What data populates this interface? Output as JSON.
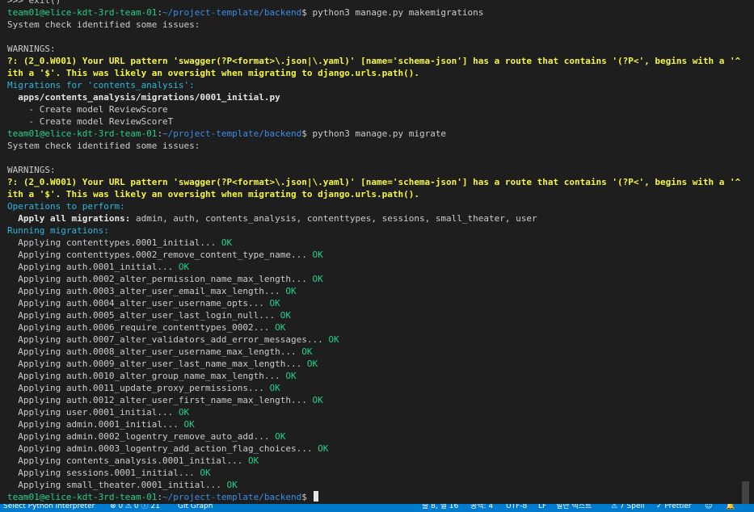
{
  "colors": {
    "background": "#1e1e1e",
    "prompt_user": "#23d18b",
    "prompt_path": "#3b8eea",
    "warning": "#f5f543",
    "section_header": "#29b8db",
    "ok": "#23d18b",
    "statusbar": "#007acc"
  },
  "terminal": {
    "lines": [
      {
        "segments": [
          {
            "text": ">>> exit()",
            "style": "white"
          }
        ]
      },
      {
        "segments": [
          {
            "text": "team01@elice-kdt-3rd-team-01",
            "style": "green"
          },
          {
            "text": ":",
            "style": "white"
          },
          {
            "text": "~/project-template/backend",
            "style": "blue"
          },
          {
            "text": "$ python3 manage.py makemigrations",
            "style": "white"
          }
        ]
      },
      {
        "segments": [
          {
            "text": "System check identified some issues:",
            "style": "white"
          }
        ]
      },
      {
        "segments": [
          {
            "text": "",
            "style": "white"
          }
        ]
      },
      {
        "segments": [
          {
            "text": "WARNINGS:",
            "style": "white"
          }
        ]
      },
      {
        "segments": [
          {
            "text": "?: (2_0.W001) Your URL pattern 'swagger(?P<format>\\.json|\\.yaml)' [name='schema-json'] has a route that contains '(?P<', begins with a '^', or ends w",
            "style": "yellow"
          }
        ]
      },
      {
        "segments": [
          {
            "text": "ith a '$'. This was likely an oversight when migrating to django.urls.path().",
            "style": "yellow"
          }
        ]
      },
      {
        "segments": [
          {
            "text": "Migrations for 'contents_analysis':",
            "style": "cyan"
          }
        ]
      },
      {
        "segments": [
          {
            "text": "  apps/contents_analysis/migrations/0001_initial.py",
            "style": "bold"
          }
        ]
      },
      {
        "segments": [
          {
            "text": "    - Create model ReviewScore",
            "style": "white"
          }
        ]
      },
      {
        "segments": [
          {
            "text": "    - Create model ReviewScoreT",
            "style": "white"
          }
        ]
      },
      {
        "segments": [
          {
            "text": "team01@elice-kdt-3rd-team-01",
            "style": "green"
          },
          {
            "text": ":",
            "style": "white"
          },
          {
            "text": "~/project-template/backend",
            "style": "blue"
          },
          {
            "text": "$ python3 manage.py migrate",
            "style": "white"
          }
        ]
      },
      {
        "segments": [
          {
            "text": "System check identified some issues:",
            "style": "white"
          }
        ]
      },
      {
        "segments": [
          {
            "text": "",
            "style": "white"
          }
        ]
      },
      {
        "segments": [
          {
            "text": "WARNINGS:",
            "style": "white"
          }
        ]
      },
      {
        "segments": [
          {
            "text": "?: (2_0.W001) Your URL pattern 'swagger(?P<format>\\.json|\\.yaml)' [name='schema-json'] has a route that contains '(?P<', begins with a '^', or ends w",
            "style": "yellow"
          }
        ]
      },
      {
        "segments": [
          {
            "text": "ith a '$'. This was likely an oversight when migrating to django.urls.path().",
            "style": "yellow"
          }
        ]
      },
      {
        "segments": [
          {
            "text": "Operations to perform:",
            "style": "cyan"
          }
        ]
      },
      {
        "segments": [
          {
            "text": "  Apply all migrations:",
            "style": "bold"
          },
          {
            "text": " admin, auth, contents_analysis, contenttypes, sessions, small_theater, user",
            "style": "white"
          }
        ]
      },
      {
        "segments": [
          {
            "text": "Running migrations:",
            "style": "cyan"
          }
        ]
      },
      {
        "segments": [
          {
            "text": "  Applying contenttypes.0001_initial...",
            "style": "white"
          },
          {
            "text": " OK",
            "style": "green"
          }
        ]
      },
      {
        "segments": [
          {
            "text": "  Applying contenttypes.0002_remove_content_type_name...",
            "style": "white"
          },
          {
            "text": " OK",
            "style": "green"
          }
        ]
      },
      {
        "segments": [
          {
            "text": "  Applying auth.0001_initial...",
            "style": "white"
          },
          {
            "text": " OK",
            "style": "green"
          }
        ]
      },
      {
        "segments": [
          {
            "text": "  Applying auth.0002_alter_permission_name_max_length...",
            "style": "white"
          },
          {
            "text": " OK",
            "style": "green"
          }
        ]
      },
      {
        "segments": [
          {
            "text": "  Applying auth.0003_alter_user_email_max_length...",
            "style": "white"
          },
          {
            "text": " OK",
            "style": "green"
          }
        ]
      },
      {
        "segments": [
          {
            "text": "  Applying auth.0004_alter_user_username_opts...",
            "style": "white"
          },
          {
            "text": " OK",
            "style": "green"
          }
        ]
      },
      {
        "segments": [
          {
            "text": "  Applying auth.0005_alter_user_last_login_null...",
            "style": "white"
          },
          {
            "text": " OK",
            "style": "green"
          }
        ]
      },
      {
        "segments": [
          {
            "text": "  Applying auth.0006_require_contenttypes_0002...",
            "style": "white"
          },
          {
            "text": " OK",
            "style": "green"
          }
        ]
      },
      {
        "segments": [
          {
            "text": "  Applying auth.0007_alter_validators_add_error_messages...",
            "style": "white"
          },
          {
            "text": " OK",
            "style": "green"
          }
        ]
      },
      {
        "segments": [
          {
            "text": "  Applying auth.0008_alter_user_username_max_length...",
            "style": "white"
          },
          {
            "text": " OK",
            "style": "green"
          }
        ]
      },
      {
        "segments": [
          {
            "text": "  Applying auth.0009_alter_user_last_name_max_length...",
            "style": "white"
          },
          {
            "text": " OK",
            "style": "green"
          }
        ]
      },
      {
        "segments": [
          {
            "text": "  Applying auth.0010_alter_group_name_max_length...",
            "style": "white"
          },
          {
            "text": " OK",
            "style": "green"
          }
        ]
      },
      {
        "segments": [
          {
            "text": "  Applying auth.0011_update_proxy_permissions...",
            "style": "white"
          },
          {
            "text": " OK",
            "style": "green"
          }
        ]
      },
      {
        "segments": [
          {
            "text": "  Applying auth.0012_alter_user_first_name_max_length...",
            "style": "white"
          },
          {
            "text": " OK",
            "style": "green"
          }
        ]
      },
      {
        "segments": [
          {
            "text": "  Applying user.0001_initial...",
            "style": "white"
          },
          {
            "text": " OK",
            "style": "green"
          }
        ]
      },
      {
        "segments": [
          {
            "text": "  Applying admin.0001_initial...",
            "style": "white"
          },
          {
            "text": " OK",
            "style": "green"
          }
        ]
      },
      {
        "segments": [
          {
            "text": "  Applying admin.0002_logentry_remove_auto_add...",
            "style": "white"
          },
          {
            "text": " OK",
            "style": "green"
          }
        ]
      },
      {
        "segments": [
          {
            "text": "  Applying admin.0003_logentry_add_action_flag_choices...",
            "style": "white"
          },
          {
            "text": " OK",
            "style": "green"
          }
        ]
      },
      {
        "segments": [
          {
            "text": "  Applying contents_analysis.0001_initial...",
            "style": "white"
          },
          {
            "text": " OK",
            "style": "green"
          }
        ]
      },
      {
        "segments": [
          {
            "text": "  Applying sessions.0001_initial...",
            "style": "white"
          },
          {
            "text": " OK",
            "style": "green"
          }
        ]
      },
      {
        "segments": [
          {
            "text": "  Applying small_theater.0001_initial...",
            "style": "white"
          },
          {
            "text": " OK",
            "style": "green"
          }
        ]
      },
      {
        "segments": [
          {
            "text": "team01@elice-kdt-3rd-team-01",
            "style": "green"
          },
          {
            "text": ":",
            "style": "white"
          },
          {
            "text": "~/project-template/backend",
            "style": "blue"
          },
          {
            "text": "$ ",
            "style": "white"
          }
        ],
        "cursor": true
      }
    ]
  },
  "statusbar": {
    "interpreter": "Select Python Interpreter",
    "problems": "⊗ 0 ⚠ 0 ⓘ 21",
    "git_graph": "Git Graph",
    "position": "줄 8, 열 16",
    "indent": "공백: 4",
    "encoding": "UTF-8",
    "eol": "LF",
    "language": "일반 텍스트",
    "spell": "⚠ 7 Spell",
    "prettier": "✓ Prettier"
  }
}
